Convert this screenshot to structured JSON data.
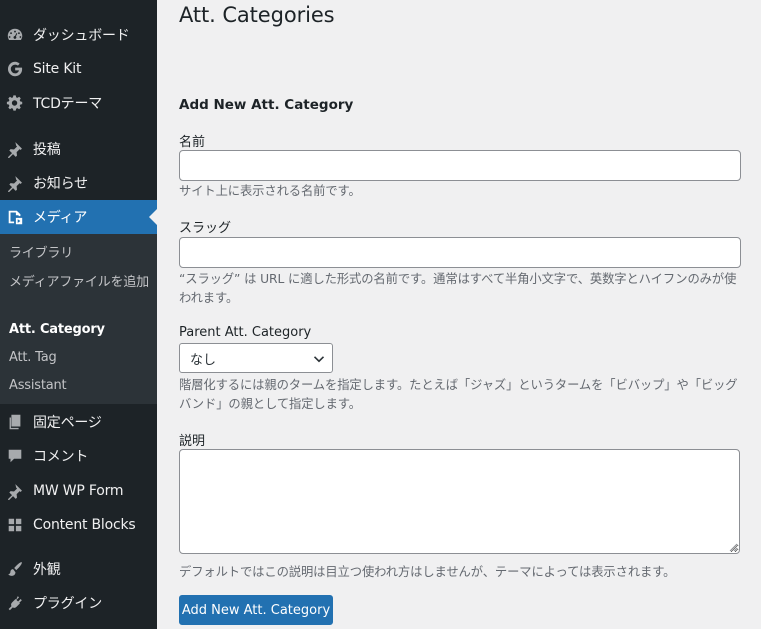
{
  "sidebar": {
    "items": [
      {
        "label": "ダッシュボード",
        "icon": "dashboard-icon"
      },
      {
        "label": "Site Kit",
        "icon": "google-g-icon"
      },
      {
        "label": "TCDテーマ",
        "icon": "gear-icon"
      },
      {
        "label": "投稿",
        "icon": "pushpin-icon"
      },
      {
        "label": "お知らせ",
        "icon": "pushpin-icon"
      },
      {
        "label": "メディア",
        "icon": "media-icon"
      },
      {
        "label": "固定ページ",
        "icon": "page-icon"
      },
      {
        "label": "コメント",
        "icon": "comment-icon"
      },
      {
        "label": "MW WP Form",
        "icon": "pushpin-icon"
      },
      {
        "label": "Content Blocks",
        "icon": "blocks-icon"
      },
      {
        "label": "外観",
        "icon": "brush-icon"
      },
      {
        "label": "プラグイン",
        "icon": "plugin-icon"
      }
    ],
    "submenu": [
      {
        "label": "ライブラリ"
      },
      {
        "label": "メディアファイルを追加"
      },
      {
        "label": "Att. Category"
      },
      {
        "label": "Att. Tag"
      },
      {
        "label": "Assistant"
      }
    ],
    "colors": {
      "background": "#1d2327",
      "submenu_bg": "#2c3338",
      "active": "#2271b1"
    }
  },
  "page": {
    "title": "Att. Categories"
  },
  "form": {
    "heading": "Add New Att. Category",
    "name_label": "名前",
    "name_value": "",
    "name_desc": "サイト上に表示される名前です。",
    "slug_label": "スラッグ",
    "slug_value": "",
    "slug_desc": "“スラッグ” は URL に適した形式の名前です。通常はすべて半角小文字で、英数字とハイフンのみが使われます。",
    "parent_label": "Parent Att. Category",
    "parent_selected": "なし",
    "parent_desc": "階層化するには親のタームを指定します。たとえば「ジャズ」というタームを「ビバップ」や「ビッグバンド」の親として指定します。",
    "description_label": "説明",
    "description_value": "",
    "description_desc": "デフォルトではこの説明は目立つ使われ方はしませんが、テーマによっては表示されます。",
    "submit_label": "Add New Att. Category"
  }
}
